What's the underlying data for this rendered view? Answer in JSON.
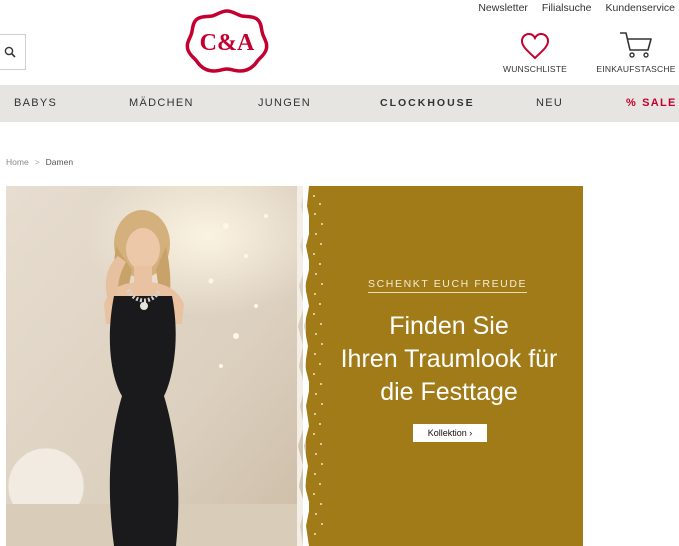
{
  "top_links": [
    "Newsletter",
    "Filialsuche",
    "Kundenservice"
  ],
  "logo": {
    "text": "C&A",
    "color": "#c3002f"
  },
  "search": {
    "icon": "search-icon"
  },
  "header_actions": {
    "wishlist": {
      "label": "WUNSCHLISTE",
      "icon": "heart-icon",
      "color": "#c3002f"
    },
    "cart": {
      "label": "EINKAUFSTASCHE",
      "icon": "cart-icon"
    }
  },
  "nav": {
    "items": [
      "BABYS",
      "MÄDCHEN",
      "JUNGEN",
      "CLOCKHOUSE",
      "NEU"
    ],
    "sale": {
      "symbol": "%",
      "label": "SALE",
      "color": "#c3002f"
    }
  },
  "breadcrumb": {
    "home": "Home",
    "separator": ">",
    "current": "Damen"
  },
  "hero": {
    "eyebrow": "SCHENKT EUCH FREUDE",
    "headline_lines": [
      "Finden Sie",
      "Ihren Traumlook für",
      "die Festtage"
    ],
    "cta_label": "Kollektion ›",
    "panel_color": "#a27b19"
  }
}
